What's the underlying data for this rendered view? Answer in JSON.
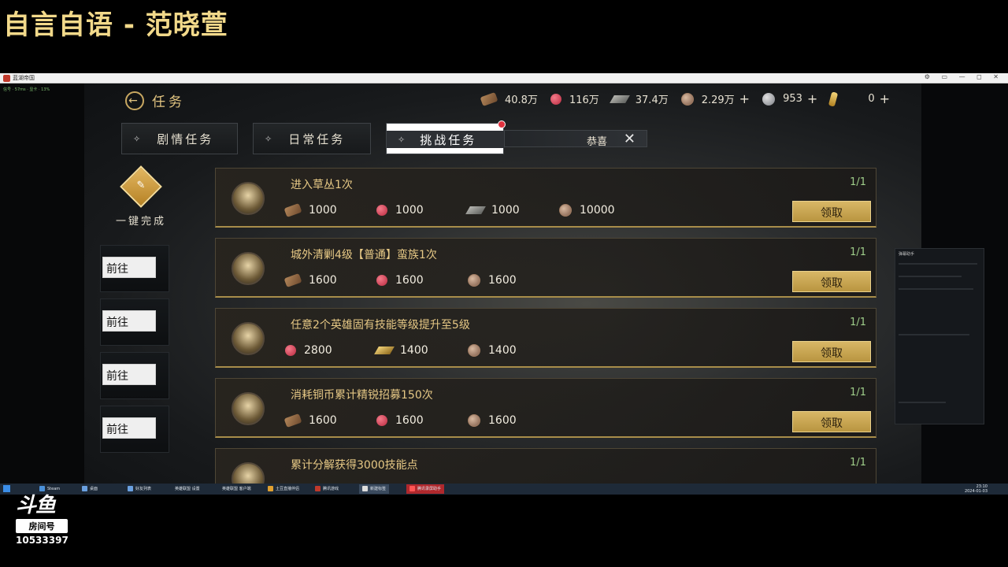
{
  "stream_title": "自言自语 - 范晓萱",
  "window": {
    "app_title": "蓝湖帝国",
    "left_strip_text": "信号 · 57ms · 显卡 · 13%"
  },
  "game": {
    "back_label": "任务",
    "resources": [
      {
        "icon": "wood-icon",
        "value": "40.8万",
        "plus": false
      },
      {
        "icon": "meat-icon",
        "value": "116万",
        "plus": false
      },
      {
        "icon": "stone-icon",
        "value": "37.4万",
        "plus": false
      },
      {
        "icon": "copper-coin-icon",
        "value": "2.29万",
        "plus": true
      },
      {
        "icon": "silver-coin-icon",
        "value": "953",
        "plus": true
      },
      {
        "icon": "gold-bar-icon",
        "value": "0",
        "plus": true
      }
    ],
    "tabs": [
      {
        "label": "剧情任务"
      },
      {
        "label": "日常任务"
      },
      {
        "label": "挑战任务"
      }
    ],
    "popup": {
      "text": "恭喜"
    },
    "onekey_label": "一键完成",
    "goto_label": "前往",
    "claim_label": "领取",
    "tasks": [
      {
        "name": "进入草丛1次",
        "progress": "1/1",
        "rewards": [
          {
            "icon": "wood-icon",
            "amount": "1000"
          },
          {
            "icon": "meat-icon",
            "amount": "1000"
          },
          {
            "icon": "stone-icon",
            "amount": "1000"
          },
          {
            "icon": "copper-coin-icon",
            "amount": "10000"
          }
        ]
      },
      {
        "name": "城外清剿4级【普通】蛮族1次",
        "progress": "1/1",
        "rewards": [
          {
            "icon": "wood-icon",
            "amount": "1600"
          },
          {
            "icon": "meat-icon",
            "amount": "1600"
          },
          {
            "icon": "copper-coin-icon",
            "amount": "1600"
          }
        ]
      },
      {
        "name": "任意2个英雄固有技能等级提升至5级",
        "progress": "1/1",
        "rewards": [
          {
            "icon": "meat-icon",
            "amount": "2800"
          },
          {
            "icon": "gold-ingot-icon",
            "amount": "1400"
          },
          {
            "icon": "copper-coin-icon",
            "amount": "1400"
          }
        ]
      },
      {
        "name": "消耗铜币累计精锐招募150次",
        "progress": "1/1",
        "rewards": [
          {
            "icon": "wood-icon",
            "amount": "1600"
          },
          {
            "icon": "meat-icon",
            "amount": "1600"
          },
          {
            "icon": "copper-coin-icon",
            "amount": "1600"
          }
        ]
      },
      {
        "name": "累计分解获得3000技能点",
        "progress": "1/1",
        "rewards": []
      }
    ]
  },
  "widget": {
    "title": "弹幕助手"
  },
  "taskbar": {
    "items": [
      "Steam",
      "桌面",
      "好友列表",
      "英雄联盟 设置",
      "英雄联盟 客户端",
      "土豆直播伴侣",
      "腾讯游戏",
      "新建标签",
      "腾讯录屏助手"
    ],
    "clock_time": "23:10",
    "clock_date": "2024-01-03"
  },
  "douyu": {
    "logo": "斗鱼",
    "room_label": "房间号",
    "room_number": "10533397"
  },
  "colors": {
    "accent_gold": "#e3c581",
    "progress_green": "#9fce8a",
    "claim_button": "#d8b766",
    "badge_red": "#e0323f"
  }
}
